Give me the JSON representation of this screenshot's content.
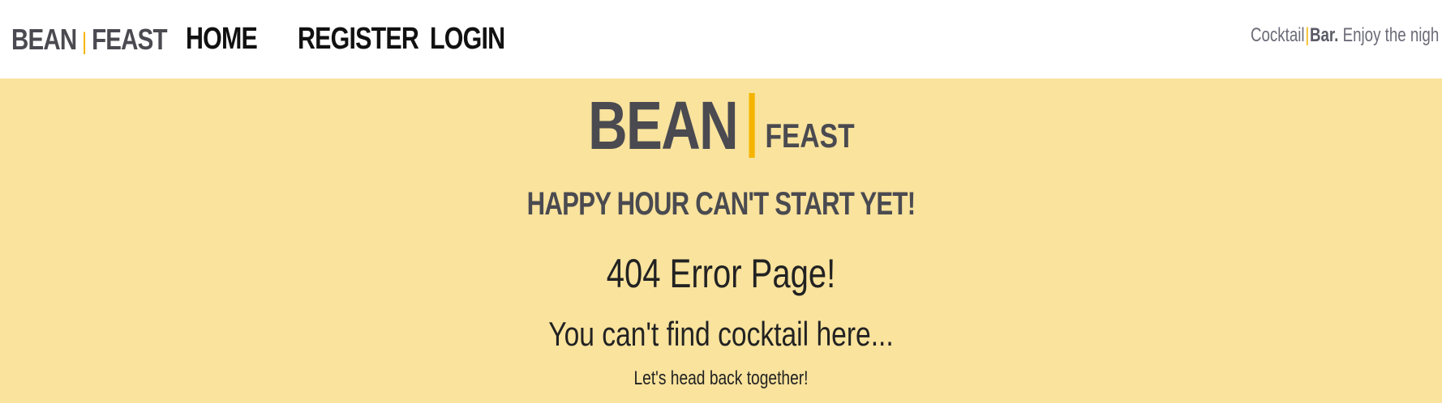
{
  "header": {
    "brand": {
      "left": "BEAN",
      "separator": "|",
      "right": "FEAST"
    },
    "nav": [
      {
        "label": "HOME"
      },
      {
        "label": "REGISTER"
      },
      {
        "label": "LOGIN"
      }
    ],
    "tagline": {
      "first": "Cocktail",
      "separator": "|",
      "bold": "Bar.",
      "rest": " Enjoy the nigh"
    }
  },
  "hero": {
    "logo": {
      "big": "BEAN",
      "small": "FEAST"
    },
    "headline": "HAPPY HOUR CAN'T START YET!",
    "error_title": "404 Error Page!",
    "error_subtitle": "You can't find cocktail here...",
    "error_note": "Let's head back together!"
  },
  "colors": {
    "accent": "#f5b400",
    "hero_background": "#f9e39d",
    "brand_text": "#4a4a50"
  }
}
